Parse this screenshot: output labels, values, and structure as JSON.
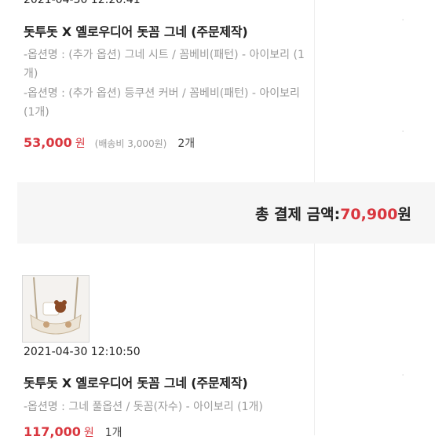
{
  "orders": [
    {
      "timestamp": "2021-04-30 12:20:41",
      "title": "돗투돗 X 옐로우디어 돗꼼 그네 (주문제작)",
      "options": [
        "-옵션명 : (추가 옵션) 그네 시트 / 꼼베비(패턴) - 아이보리 (1개)",
        "-옵션명 : (추가 옵션) 등쿠션 커버 / 꼼베비(패턴) - 아이보리 (1개)"
      ],
      "price": "53,000",
      "currency": "원",
      "shipping": "(배송비 3,000원)",
      "quantity": "2개"
    },
    {
      "timestamp": "2021-04-30 12:10:50",
      "title": "돗투돗 X 옐로우디어 돗꼼 그네 (주문제작)",
      "options": [
        "-옵션명 : 그네 풀옵션 / 돗꼼(자수) - 아이보리 (1개)"
      ],
      "price": "117,000",
      "currency": "원",
      "quantity": "1개"
    }
  ],
  "total": {
    "label": "총 결제 금액:",
    "amount": "70,900",
    "currency": "원"
  },
  "colors": {
    "price_red": "#d9363e",
    "option_gray": "#9a9a9a",
    "total_bar_bg": "#f6f6f6"
  }
}
